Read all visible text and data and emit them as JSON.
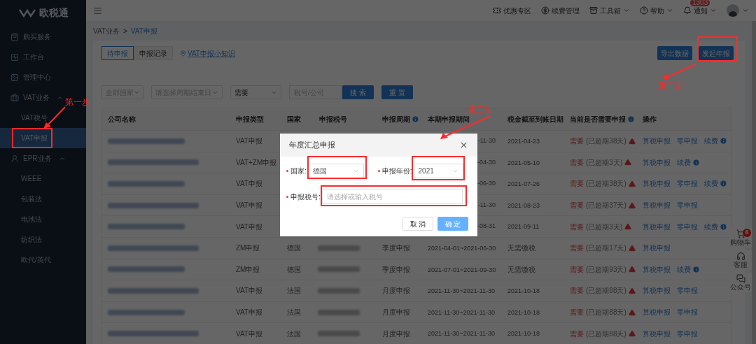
{
  "logo": {
    "name": "欧税通"
  },
  "sidebar": {
    "items": [
      {
        "label": "购买服务",
        "selected": false
      },
      {
        "label": "工作台",
        "selected": false
      },
      {
        "label": "管理中心",
        "selected": false
      },
      {
        "label": "VAT业务",
        "expanded": true,
        "children": [
          {
            "label": "VAT税号",
            "selected": false
          },
          {
            "label": "VAT申报",
            "selected": true
          }
        ]
      },
      {
        "label": "EPR业务",
        "expanded": true,
        "children": [
          {
            "label": "WEEE",
            "selected": false
          },
          {
            "label": "包装法",
            "selected": false
          },
          {
            "label": "电池法",
            "selected": false
          },
          {
            "label": "纺织法",
            "selected": false
          },
          {
            "label": "欧代/英代",
            "selected": false
          }
        ]
      }
    ]
  },
  "topbar": {
    "items": [
      {
        "label": "优惠专区",
        "dropdown": false
      },
      {
        "label": "续费管理",
        "dropdown": false
      },
      {
        "label": "工具箱",
        "dropdown": true
      },
      {
        "label": "帮助",
        "dropdown": true
      },
      {
        "label": "通知",
        "dropdown": true,
        "badge": "1303"
      }
    ]
  },
  "breadcrumb": [
    "VAT业务",
    "VAT申报"
  ],
  "breadcrumb_separator": ">",
  "tabs": [
    {
      "label": "待申报",
      "selected": true
    },
    {
      "label": "申报记录",
      "selected": false
    }
  ],
  "help_link": "VAT申报小知识",
  "header_buttons": [
    "导出数据",
    "发起年报"
  ],
  "filters": [
    {
      "kind": "select",
      "placeholder": "全部国家"
    },
    {
      "kind": "select",
      "placeholder": "请选择周期结束日"
    },
    {
      "kind": "select",
      "value": "需要"
    },
    {
      "kind": "input",
      "placeholder": "税号/公司"
    },
    {
      "kind": "button",
      "label": "搜 索"
    },
    {
      "kind": "button",
      "label": "重 置"
    }
  ],
  "table": {
    "columns": [
      {
        "label": "公司名称"
      },
      {
        "label": "申报类型"
      },
      {
        "label": "国家"
      },
      {
        "label": "申报税号"
      },
      {
        "label": "申报周期",
        "info": true
      },
      {
        "label": "本期申报期间"
      },
      {
        "label": "税金截至到账日期"
      },
      {
        "label": "当前是否需要申报",
        "info": true
      },
      {
        "label": "操作"
      }
    ],
    "rows": [
      {
        "type": "VAT申报",
        "period": "-11-30",
        "due": "2021-04-23",
        "need": "需要",
        "overdue": "(已超期38天)",
        "ops": [
          {
            "label": "算税申报",
            "info": false
          },
          {
            "label": "零申报",
            "info": false
          },
          {
            "label": "续费",
            "info": true
          }
        ]
      },
      {
        "type": "VAT+ZM申报",
        "period": "-04-30",
        "due": "2021-05-10",
        "need": "需要",
        "overdue": "(已超期3天)",
        "ops": [
          {
            "label": "算税申报",
            "info": false
          },
          {
            "label": "续费",
            "info": true
          }
        ]
      },
      {
        "type": "VAT申报",
        "period": "-06-30",
        "due": "2021-07-26",
        "need": "需要",
        "overdue": "(已超期38天)",
        "ops": [
          {
            "label": "算税申报",
            "info": false
          },
          {
            "label": "零申报",
            "info": false
          },
          {
            "label": "续费",
            "info": true
          }
        ]
      },
      {
        "type": "VAT申报",
        "period": "-11-30",
        "due": "2021-08-23",
        "need": "需要",
        "overdue": "(已超期37天)",
        "ops": [
          {
            "label": "算税申报",
            "info": false
          },
          {
            "label": "零申报",
            "info": false
          }
        ]
      },
      {
        "type": "VAT申报",
        "period": "-08-31",
        "due": "2021-09-11",
        "need": "需要",
        "overdue": "(已超期3天)",
        "ops": [
          {
            "label": "算税申报",
            "info": false
          },
          {
            "label": "零申报",
            "info": false
          },
          {
            "label": "续费",
            "info": true
          }
        ]
      },
      {
        "type": "ZM申报",
        "country": "德国",
        "cycle": "季度申报",
        "period": "2021-04-01~2021-06-30",
        "due": "无需缴税",
        "need": "需要",
        "overdue": "(已超期17天)",
        "ops": [
          {
            "label": "算税申报",
            "info": false
          }
        ]
      },
      {
        "type": "ZM申报",
        "country": "德国",
        "cycle": "季度申报",
        "period": "2021-07-01~2021-09-30",
        "due": "无需缴税",
        "need": "需要",
        "overdue": "(已超期93天)",
        "ops": [
          {
            "label": "算税申报",
            "info": false
          },
          {
            "label": "续费",
            "info": true
          }
        ]
      },
      {
        "type": "VAT申报",
        "country": "法国",
        "cycle": "月度申报",
        "period": "2021-11-30~2021-11-30",
        "due": "2021-10-18",
        "need": "需要",
        "overdue": "(已超期88天)",
        "ops": [
          {
            "label": "算税申报",
            "info": false
          },
          {
            "label": "零申报",
            "info": false
          }
        ]
      },
      {
        "type": "VAT申报",
        "country": "法国",
        "cycle": "月度申报",
        "period": "2021-11-30~2021-11-30",
        "due": "2021-10-18",
        "need": "需要",
        "overdue": "(已超期88天)",
        "ops": [
          {
            "label": "算税申报",
            "info": false
          },
          {
            "label": "零申报",
            "info": false
          }
        ]
      },
      {
        "type": "VAT申报",
        "country": "法国",
        "cycle": "月度申报",
        "period": "2021-11-30~2021-11-30",
        "due": "2021-10-18",
        "need": "需要",
        "overdue": "(已超期88天)",
        "ops": [
          {
            "label": "算税申报",
            "info": false
          },
          {
            "label": "零申报",
            "info": false
          }
        ]
      }
    ]
  },
  "float_panel": [
    {
      "label": "购物车",
      "badge": "6"
    },
    {
      "label": "客服"
    },
    {
      "label": "公众号"
    }
  ],
  "modal": {
    "title": "年度汇总申报",
    "fields": [
      {
        "label": "国家:",
        "required": true,
        "value": "德国"
      },
      {
        "label": "申报年份:",
        "required": true,
        "value": "2021"
      },
      {
        "label": "申报税号:",
        "required": true,
        "placeholder": "请选择或输入税号"
      }
    ],
    "buttons": [
      {
        "label": "取 消",
        "kind": "default"
      },
      {
        "label": "确 定",
        "kind": "primary"
      }
    ]
  },
  "annotations": [
    {
      "text": "第一步"
    },
    {
      "text": "第二步"
    },
    {
      "text": "第三步"
    }
  ]
}
